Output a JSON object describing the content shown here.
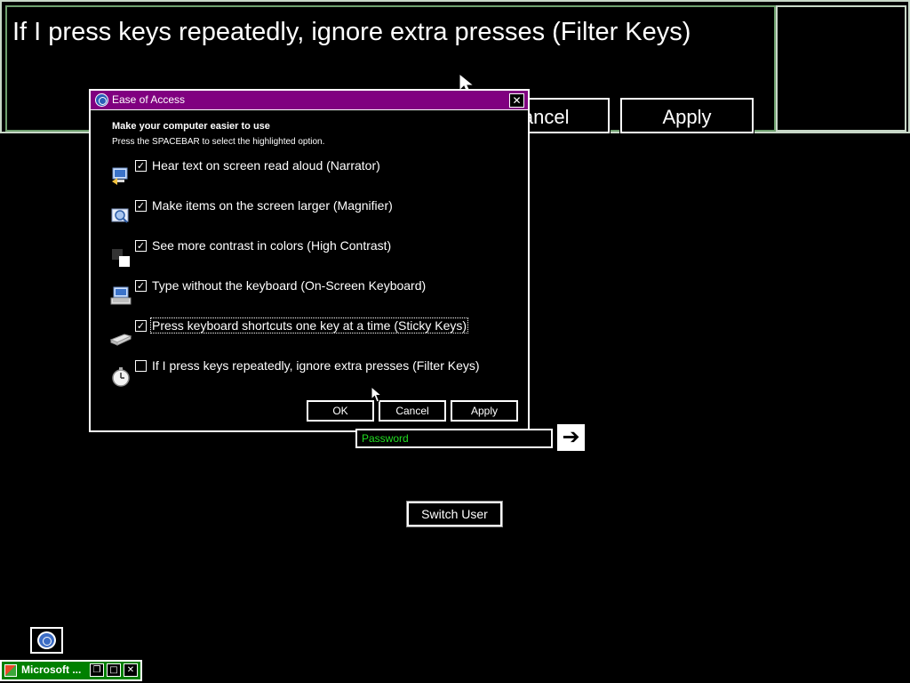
{
  "magnifier": {
    "text": "If I press keys repeatedly, ignore extra presses (Filter Keys)",
    "cancel_label": "Cancel",
    "apply_label": "Apply"
  },
  "dialog": {
    "title": "Ease of Access",
    "close_glyph": "✕",
    "heading": "Make your computer easier to use",
    "subheading": "Press the SPACEBAR to select the highlighted option.",
    "options": [
      {
        "label": "Hear text on screen read aloud (Narrator)",
        "checked": true,
        "icon": "narrator-icon"
      },
      {
        "label": "Make items on the screen larger (Magnifier)",
        "checked": true,
        "icon": "magnifier-icon"
      },
      {
        "label": "See more contrast in colors (High Contrast)",
        "checked": true,
        "icon": "high-contrast-icon"
      },
      {
        "label": "Type without the keyboard (On-Screen Keyboard)",
        "checked": true,
        "icon": "on-screen-keyboard-icon"
      },
      {
        "label": "Press keyboard shortcuts one key at a time (Sticky Keys)",
        "checked": true,
        "icon": "sticky-keys-icon",
        "focused": true
      },
      {
        "label": "If I press keys repeatedly, ignore extra presses (Filter Keys)",
        "checked": false,
        "icon": "filter-keys-icon"
      }
    ],
    "buttons": {
      "ok": "OK",
      "cancel": "Cancel",
      "apply": "Apply"
    }
  },
  "logon": {
    "password_placeholder": "Password",
    "arrow_glyph": "➔",
    "switch_user": "Switch User"
  },
  "taskbar": {
    "label": "Microsoft ...",
    "restore_glyph": "❐",
    "maximize_glyph": "□",
    "close_glyph": "✕"
  },
  "colors": {
    "titlebar": "#800080",
    "placeholder": "#22dd22",
    "taskbar": "#008000"
  }
}
